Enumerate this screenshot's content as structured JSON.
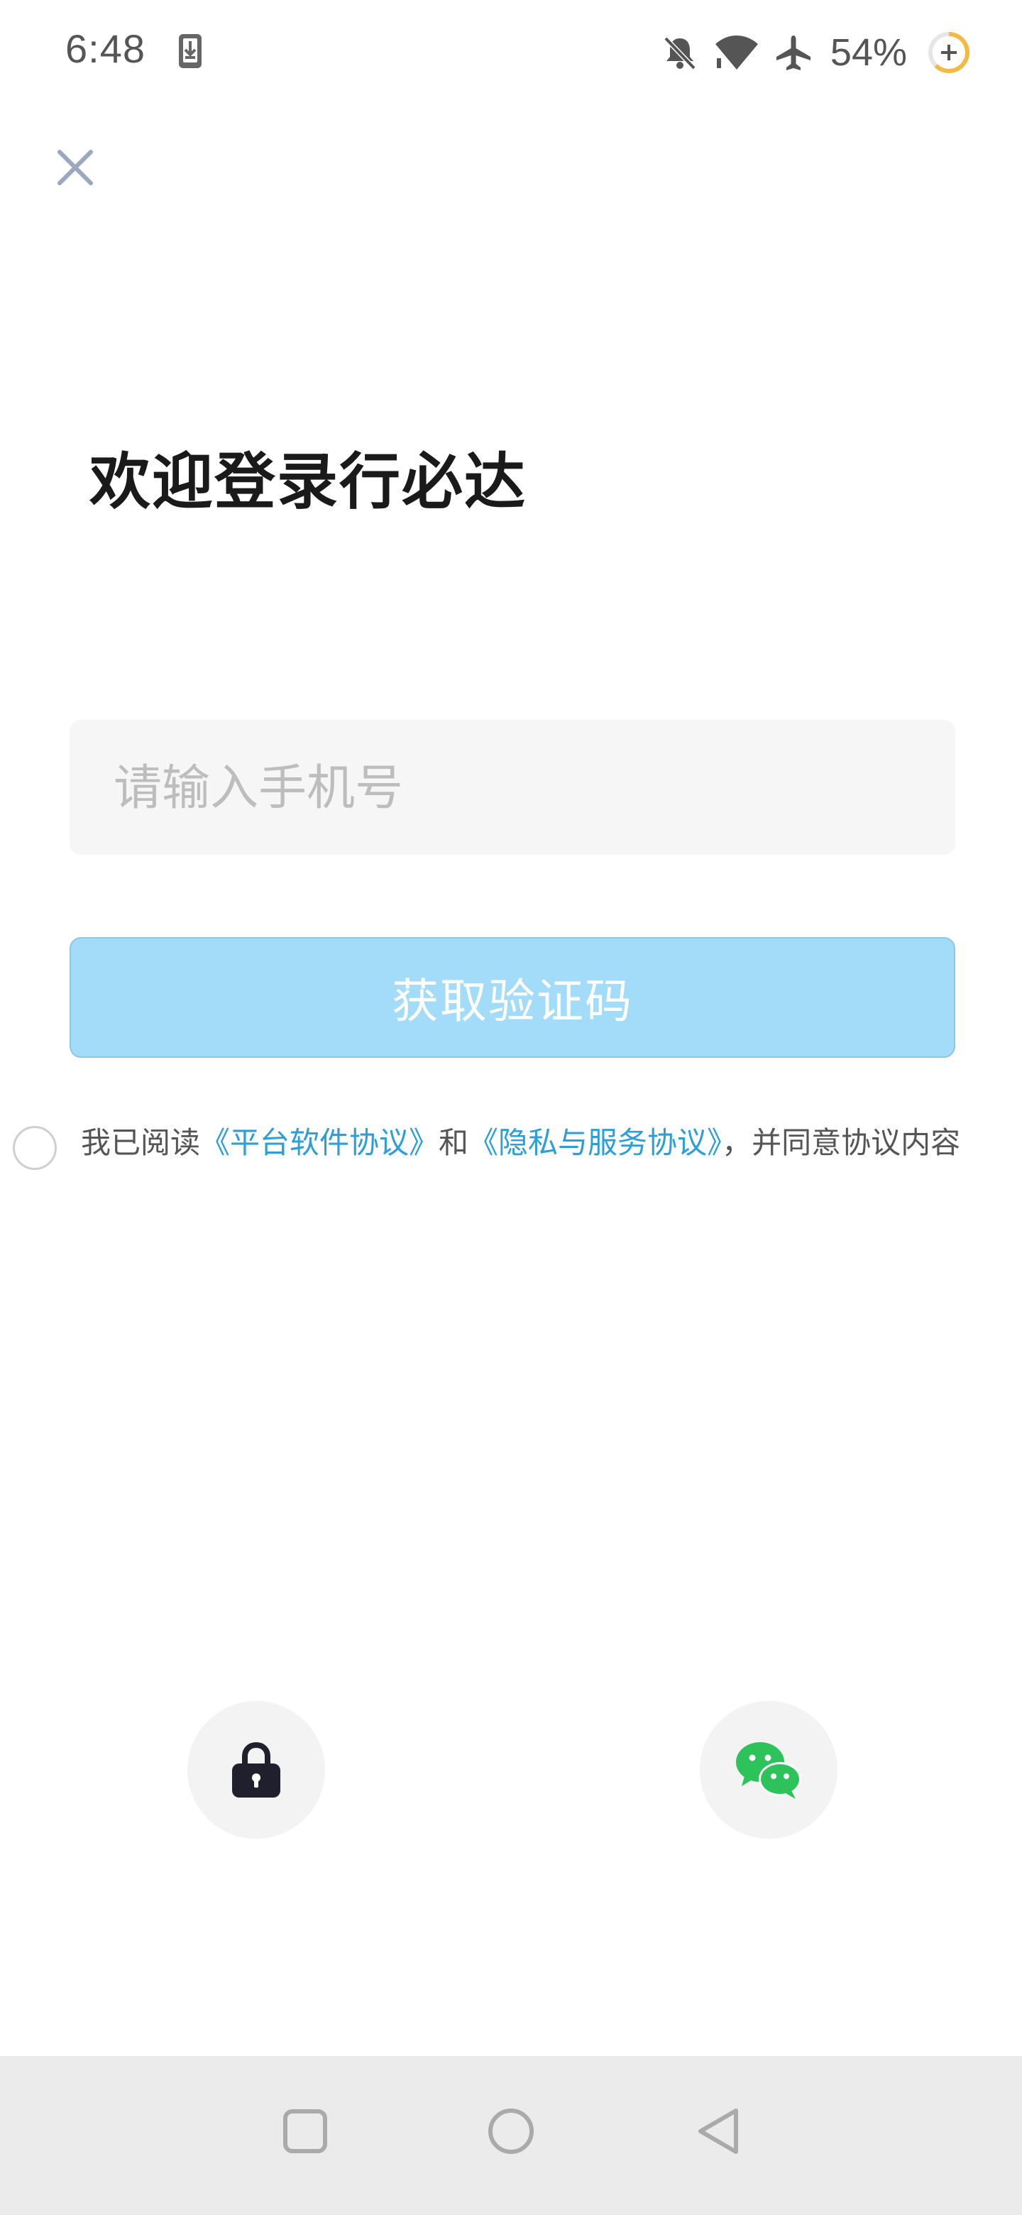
{
  "status_bar": {
    "time": "6:48",
    "battery": "54%",
    "icons": [
      "download-icon",
      "bell-off-icon",
      "wifi-icon",
      "airplane-icon",
      "battery-icon"
    ]
  },
  "header": {
    "close_icon": "close-icon"
  },
  "title": "欢迎登录行必达",
  "phone": {
    "value": "",
    "placeholder": "请输入手机号"
  },
  "get_code_button": "获取验证码",
  "agreement": {
    "prefix": "我已阅读",
    "link1": "《平台软件协议》",
    "middle": "和",
    "link2": "《隐私与服务协议》",
    "suffix": "，并同意协议内容"
  },
  "alt_login": {
    "password_icon": "lock-icon",
    "wechat_icon": "wechat-icon"
  },
  "colors": {
    "button_bg": "#a2dcf8",
    "link": "#2c9ed8",
    "wechat": "#2dc35a",
    "lock": "#1f1f2e"
  },
  "nav_bar": {
    "icons": [
      "recent-apps-icon",
      "home-icon",
      "back-icon"
    ]
  }
}
